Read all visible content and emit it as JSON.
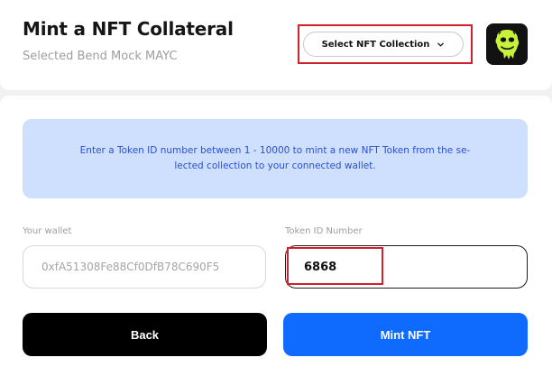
{
  "header": {
    "title": "Mint a NFT Collateral",
    "subtitle": "Selected Bend Mock MAYC",
    "collection_button_label": "Select NFT Collection"
  },
  "info": {
    "message": "Enter a Token ID number between 1 - 10000 to mint a new NFT Token from the se-lected collection to your connected wallet."
  },
  "wallet": {
    "label": "Your wallet",
    "value": "0xfA51308Fe88Cf0DfB78C690F5"
  },
  "token": {
    "label": "Token ID Number",
    "value": "6868"
  },
  "actions": {
    "back_label": "Back",
    "mint_label": "Mint NFT"
  },
  "colors": {
    "accent": "#0f6bfd",
    "info_bg": "#cfe0ff",
    "highlight": "#d0202e"
  }
}
